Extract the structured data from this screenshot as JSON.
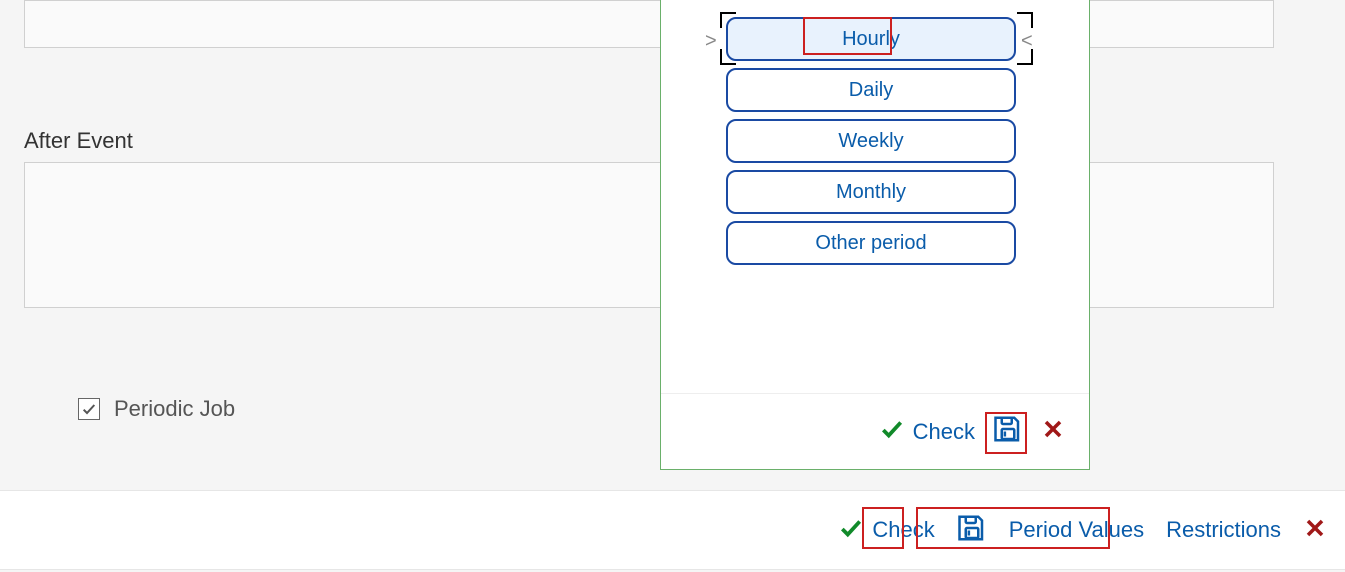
{
  "section_label": "After Event",
  "periodic_job": {
    "label": "Periodic Job",
    "checked": true
  },
  "modal": {
    "pointer_left": ">",
    "pointer_right": "<",
    "periods": [
      "Hourly",
      "Daily",
      "Weekly",
      "Monthly",
      "Other period"
    ],
    "selected_index": 0,
    "footer": {
      "check": "Check"
    }
  },
  "footer": {
    "check": "Check",
    "period_values": "Period Values",
    "restrictions": "Restrictions"
  }
}
